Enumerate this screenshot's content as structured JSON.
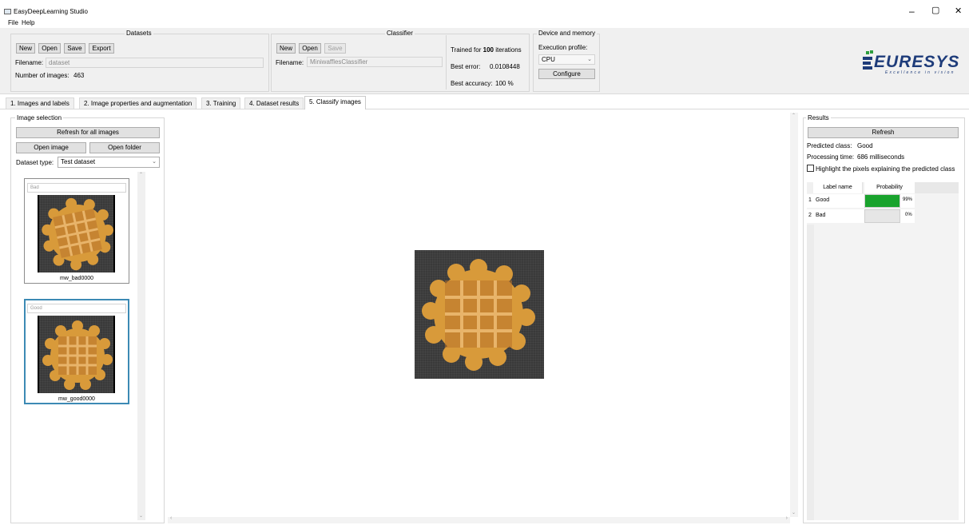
{
  "window": {
    "title": "EasyDeepLearning Studio",
    "minimize": "–",
    "maximize": "▢",
    "close": "✕"
  },
  "menu": {
    "file": "File",
    "help": "Help"
  },
  "datasets": {
    "title": "Datasets",
    "new_label": "New",
    "open_label": "Open",
    "save_label": "Save",
    "export_label": "Export",
    "filename_label": "Filename:",
    "filename_value": "dataset",
    "num_images_label": "Number of images:",
    "num_images_value": "463"
  },
  "classifier": {
    "title": "Classifier",
    "new_label": "New",
    "open_label": "Open",
    "save_label": "Save",
    "filename_label": "Filename:",
    "filename_value": "MiniwafflesClassifier",
    "trained_prefix": "Trained for",
    "trained_iterations": "100",
    "trained_suffix": "iterations",
    "best_error_label": "Best error:",
    "best_error_value": "0.0108448",
    "best_accuracy_label": "Best accuracy:",
    "best_accuracy_value": "100 %"
  },
  "device": {
    "title": "Device and memory",
    "execution_profile_label": "Execution profile:",
    "execution_profile_value": "CPU",
    "configure_label": "Configure"
  },
  "logo": {
    "text": "EURESYS",
    "tagline": "Excellence in vision"
  },
  "tabs": [
    {
      "label": "1. Images and labels"
    },
    {
      "label": "2. Image properties and augmentation"
    },
    {
      "label": "3. Training"
    },
    {
      "label": "4. Dataset results"
    },
    {
      "label": "5. Classify images"
    }
  ],
  "image_selection": {
    "title": "Image selection",
    "refresh_all_label": "Refresh for all images",
    "open_image_label": "Open image",
    "open_folder_label": "Open folder",
    "dataset_type_label": "Dataset type:",
    "dataset_type_value": "Test dataset",
    "thumbnails": [
      {
        "label": "Bad",
        "name": "mw_bad0000"
      },
      {
        "label": "Good",
        "name": "mw_good0000"
      }
    ]
  },
  "results": {
    "title": "Results",
    "refresh_label": "Refresh",
    "predicted_class_label": "Predicted class:",
    "predicted_class_value": "Good",
    "processing_time_label": "Processing time:",
    "processing_time_value": "686 milliseconds",
    "highlight_label": "Highlight the pixels explaining the predicted class",
    "table_headers": [
      "Label name",
      "Probability"
    ],
    "rows": [
      {
        "index": "1",
        "label": "Good",
        "probability": 0.99,
        "probability_text": "99%"
      },
      {
        "index": "2",
        "label": "Bad",
        "probability": 0.0,
        "probability_text": "0%"
      }
    ]
  },
  "colors": {
    "accent": "#0078d7",
    "probability_bar": "#19a32d",
    "selected_border": "#3c8ab4"
  }
}
